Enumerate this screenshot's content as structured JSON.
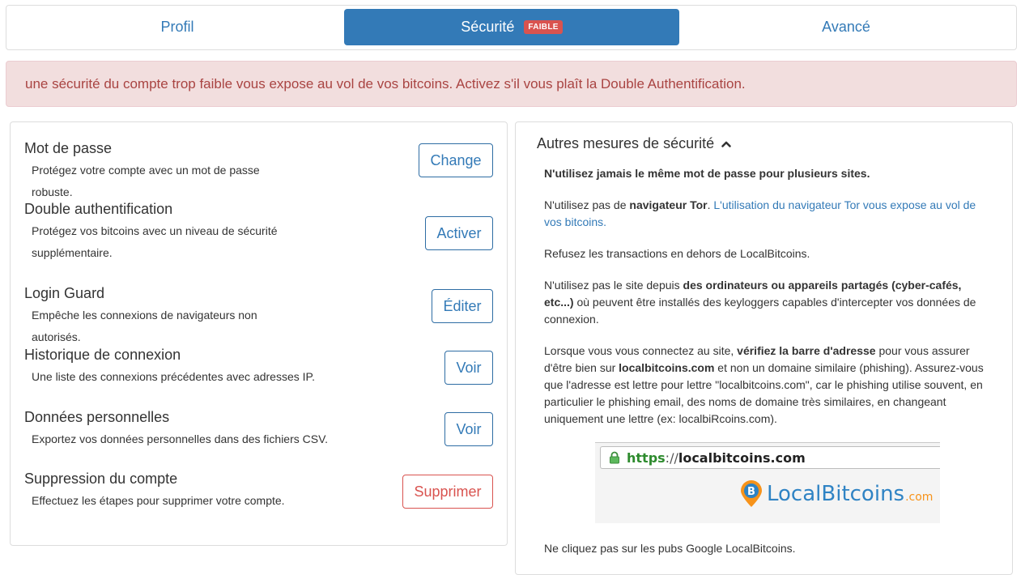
{
  "tabs": [
    {
      "label": "Profil"
    },
    {
      "label": "Sécurité",
      "badge": "FAIBLE"
    },
    {
      "label": "Avancé"
    }
  ],
  "alert": {
    "text": "une sécurité du compte trop faible vous expose au vol de vos bitcoins. Activez s'il vous plaît la Double Authentification."
  },
  "settings": [
    {
      "title": "Mot de passe",
      "desc": "Protégez votre compte avec un mot de passe robuste.",
      "button": "Change"
    },
    {
      "title": "Double authentification",
      "desc": "Protégez vos bitcoins avec un niveau de sécurité supplémentaire.",
      "button": "Activer"
    },
    {
      "title": "Login Guard",
      "desc": "Empêche les connexions de navigateurs non autorisés.",
      "button": "Éditer"
    },
    {
      "title": "Historique de connexion",
      "desc": "Une liste des connexions précédentes avec adresses IP.",
      "button": "Voir"
    },
    {
      "title": "Données personnelles",
      "desc": "Exportez vos données personnelles dans des fichiers CSV.",
      "button": "Voir"
    },
    {
      "title": "Suppression du compte",
      "desc": "Effectuez les étapes pour supprimer votre compte.",
      "button": "Supprimer"
    }
  ],
  "other": {
    "heading": "Autres mesures de sécurité",
    "p1": "N'utilisez jamais le même mot de passe pour plusieurs sites.",
    "p2_a": "N'utilisez pas de ",
    "p2_b": "navigateur Tor",
    "p2_c": ". ",
    "p2_link": "L'utilisation du navigateur Tor vous expose au vol de vos bitcoins.",
    "p3": "Refusez les transactions en dehors de LocalBitcoins.",
    "p4_a": "N'utilisez pas le site depuis ",
    "p4_b": "des ordinateurs ou appareils partagés (cyber-cafés, etc...)",
    "p4_c": " où peuvent être installés des keyloggers capables d'intercepter vos données de connexion.",
    "p5_a": "Lorsque vous vous connectez au site, ",
    "p5_b": "vérifiez la barre d'adresse",
    "p5_c": " pour vous assurer d'être bien sur ",
    "p5_d": "localbitcoins.com",
    "p5_e": " et non un domaine similaire (phishing). Assurez-vous que l'adresse est lettre pour lettre \"localbitcoins.com\", car le phishing utilise souvent, en particulier le phishing email, des noms de domaine très similaires, en changeant uniquement une lettre (ex: localbiRcoins.com).",
    "image": {
      "https": "https",
      "slashes": "://",
      "domain": "localbitcoins.com",
      "logo": "LocalBitcoins",
      "logo_suffix": ".com"
    },
    "p6": "Ne cliquez pas sur les pubs Google LocalBitcoins."
  },
  "colors": {
    "primary": "#337ab7",
    "danger": "#d9534f",
    "alert_bg": "#f2dede",
    "alert_text": "#a94442"
  }
}
